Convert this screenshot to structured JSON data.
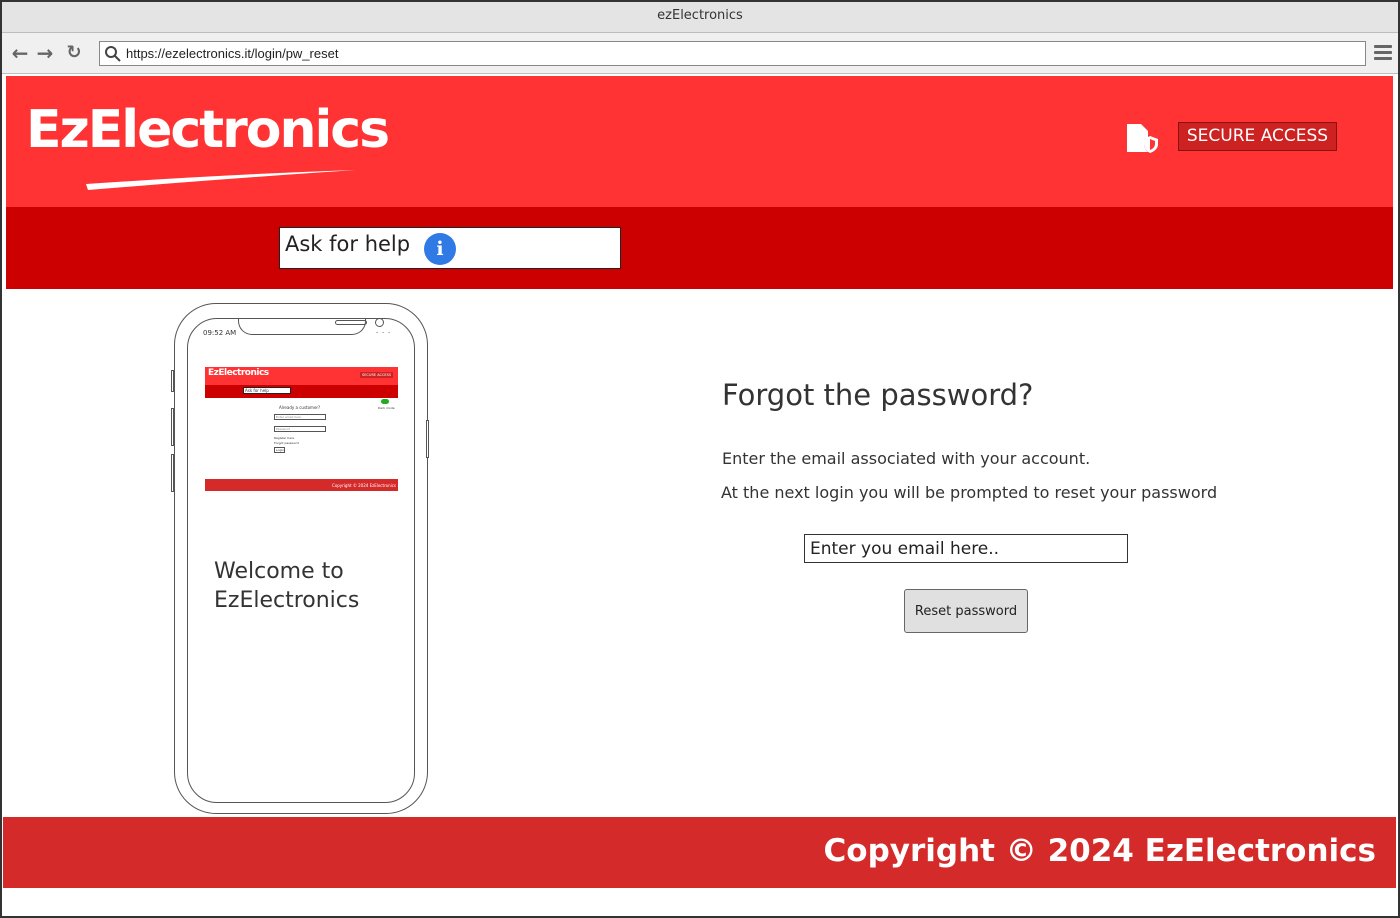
{
  "browser": {
    "window_title": "ezElectronics",
    "url": "https://ezelectronics.it/login/pw_reset"
  },
  "header": {
    "logo_text": "EzElectronics",
    "secure_access_label": "SECURE ACCESS"
  },
  "navbar": {
    "help_label": "Ask for help",
    "help_icon": "i"
  },
  "phone": {
    "time": "09:52 AM",
    "welcome_text": "Welcome to EzElectronics",
    "mini": {
      "logo": "EzElectronics",
      "secure": "SECURE ACCESS",
      "help": "Ask for help",
      "already_customer": "Already a customer?",
      "email_placeholder": "Enter email here",
      "password_placeholder": "Password",
      "register": "Register here",
      "forgot": "Forgot password",
      "login": "Login",
      "dark_mode": "Dark mode",
      "footer": "Copyright © 2024 EzElectronics"
    }
  },
  "reset": {
    "title": "Forgot the password?",
    "line1": "Enter the email associated with your account.",
    "line2": "At the next login you will be prompted to reset your password",
    "email_placeholder": "Enter you email here..",
    "button_label": "Reset password"
  },
  "footer": {
    "copyright": "Copyright © 2024 EzElectronics"
  },
  "colors": {
    "header_red": "#ff3333",
    "nav_red": "#cc0000",
    "footer_red": "#d42a2a",
    "info_blue": "#2f7ae5"
  }
}
